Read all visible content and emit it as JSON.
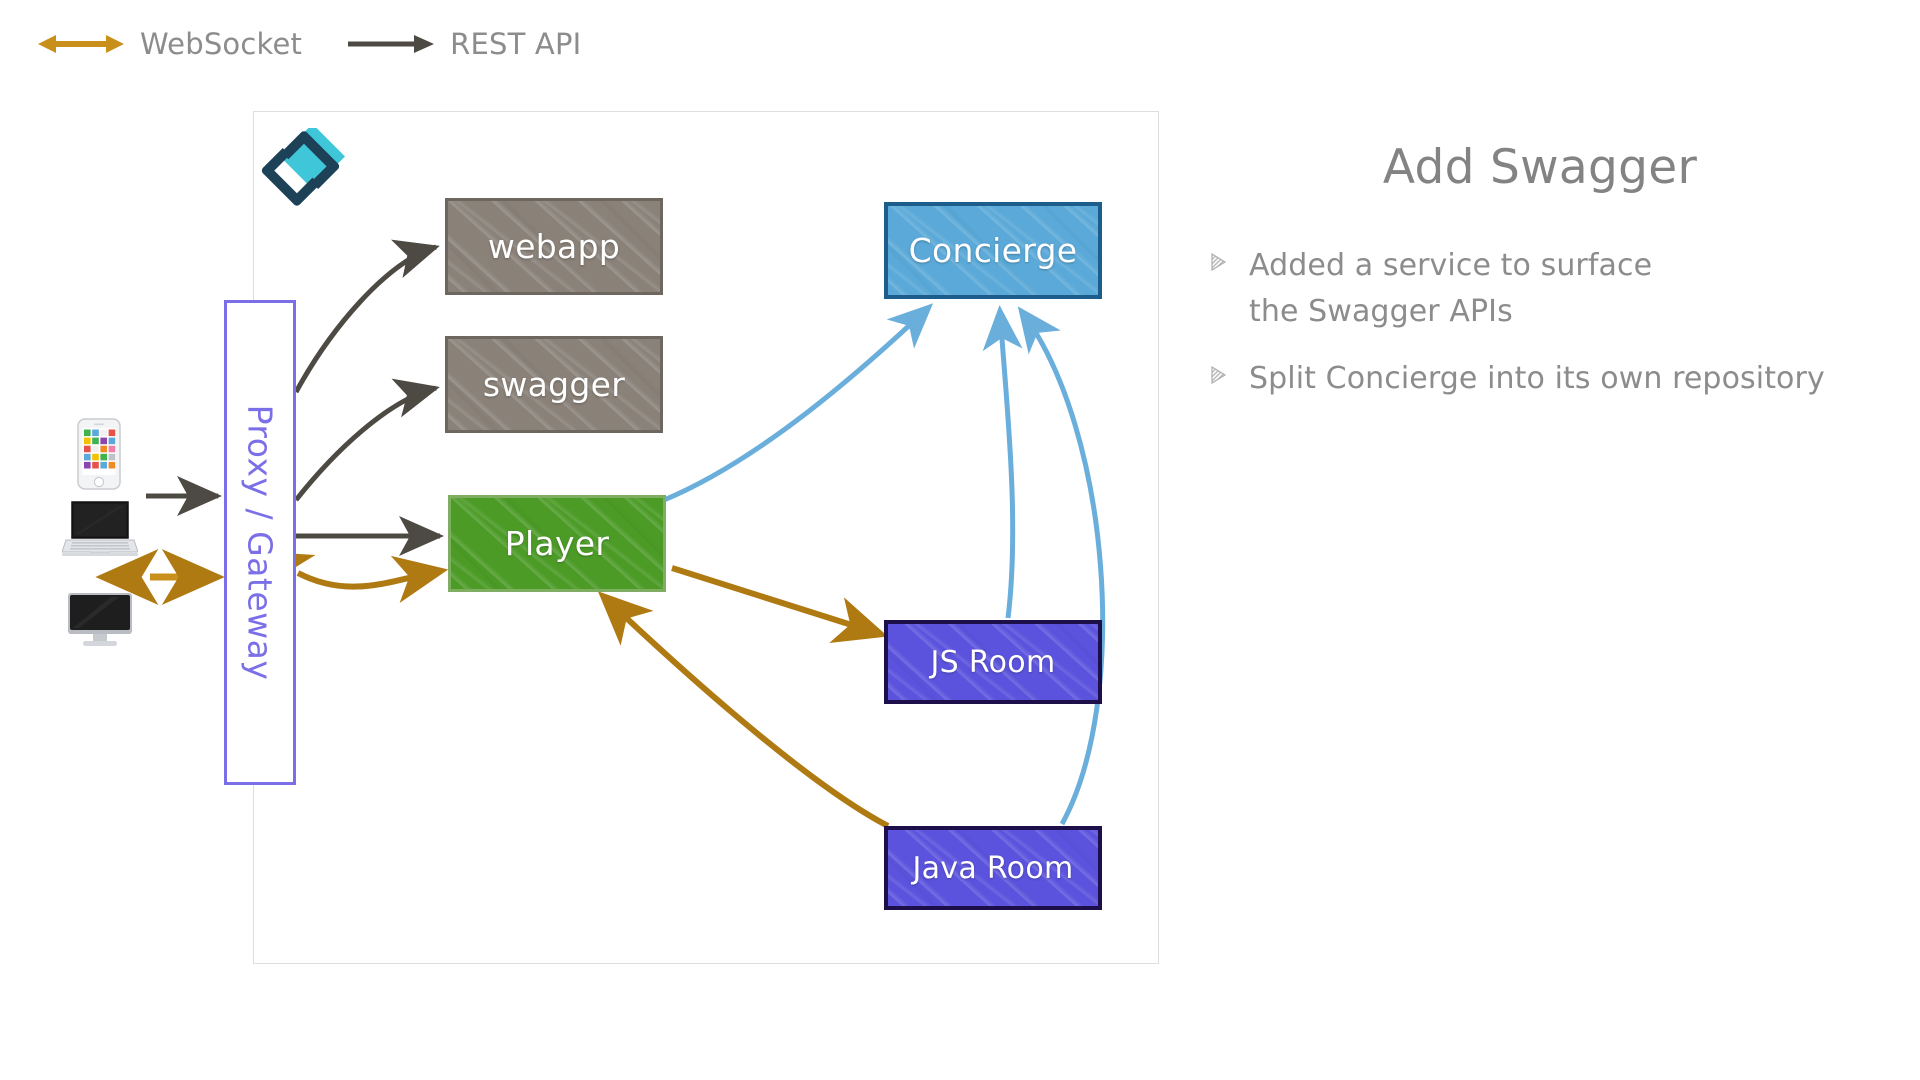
{
  "legend": {
    "items": [
      {
        "label": "WebSocket",
        "icon": "bidirectional-arrow-icon",
        "color": "#c8901b",
        "direction": "both"
      },
      {
        "label": "REST API",
        "icon": "arrow-right-icon",
        "color": "#4d4a44",
        "direction": "right"
      }
    ]
  },
  "diagram": {
    "logo": {
      "icon": "gameon-logo-icon",
      "dark_color": "#1d4258",
      "accent_color": "#3fc6d8"
    },
    "proxy": {
      "label": "Proxy / Gateway",
      "color": "#7b6fe8"
    },
    "devices": [
      {
        "name": "phone-icon",
        "label": "Mobile phone"
      },
      {
        "name": "laptop-icon",
        "label": "Laptop"
      },
      {
        "name": "desktop-icon",
        "label": "Desktop monitor"
      }
    ],
    "nodes": [
      {
        "id": "webapp",
        "label": "webapp",
        "fill": "#8a8279",
        "stroke": "#6e675f"
      },
      {
        "id": "swagger",
        "label": "swagger",
        "fill": "#8a8279",
        "stroke": "#6e675f"
      },
      {
        "id": "player",
        "label": "Player",
        "fill": "#4c9b27",
        "stroke": "#7fae63"
      },
      {
        "id": "concierge",
        "label": "Concierge",
        "fill": "#5aa9d8",
        "stroke": "#1d5d8c"
      },
      {
        "id": "jsroom",
        "label": "JS Room",
        "fill": "#5b53dd",
        "stroke": "#1d0f4a"
      },
      {
        "id": "javaroom",
        "label": "Java Room",
        "fill": "#5b53dd",
        "stroke": "#1d0f4a"
      }
    ],
    "edges": [
      {
        "from": "client",
        "to": "proxy",
        "kind": "REST API",
        "color": "#4d4a44",
        "direction": "right"
      },
      {
        "from": "client",
        "to": "proxy",
        "kind": "WebSocket",
        "color": "#c8901b",
        "direction": "both"
      },
      {
        "from": "proxy",
        "to": "webapp",
        "kind": "REST API",
        "color": "#4d4a44",
        "direction": "right"
      },
      {
        "from": "proxy",
        "to": "swagger",
        "kind": "REST API",
        "color": "#4d4a44",
        "direction": "right"
      },
      {
        "from": "proxy",
        "to": "player",
        "kind": "REST API",
        "color": "#4d4a44",
        "direction": "right"
      },
      {
        "from": "player",
        "to": "proxy",
        "kind": "WebSocket",
        "color": "#c8901b",
        "direction": "both"
      },
      {
        "from": "player",
        "to": "concierge",
        "kind": "REST API",
        "color": "#6aaedb",
        "direction": "right"
      },
      {
        "from": "jsroom",
        "to": "concierge",
        "kind": "REST API",
        "color": "#6aaedb",
        "direction": "right"
      },
      {
        "from": "javaroom",
        "to": "concierge",
        "kind": "REST API",
        "color": "#6aaedb",
        "direction": "right"
      },
      {
        "from": "player",
        "to": "jsroom",
        "kind": "WebSocket",
        "color": "#b07a12",
        "direction": "right"
      },
      {
        "from": "javaroom",
        "to": "player",
        "kind": "WebSocket",
        "color": "#b07a12",
        "direction": "right"
      }
    ]
  },
  "content": {
    "title": "Add Swagger",
    "bullets": [
      "Added a service to surface the Swagger APIs",
      "Split Concierge into its own repository"
    ]
  }
}
